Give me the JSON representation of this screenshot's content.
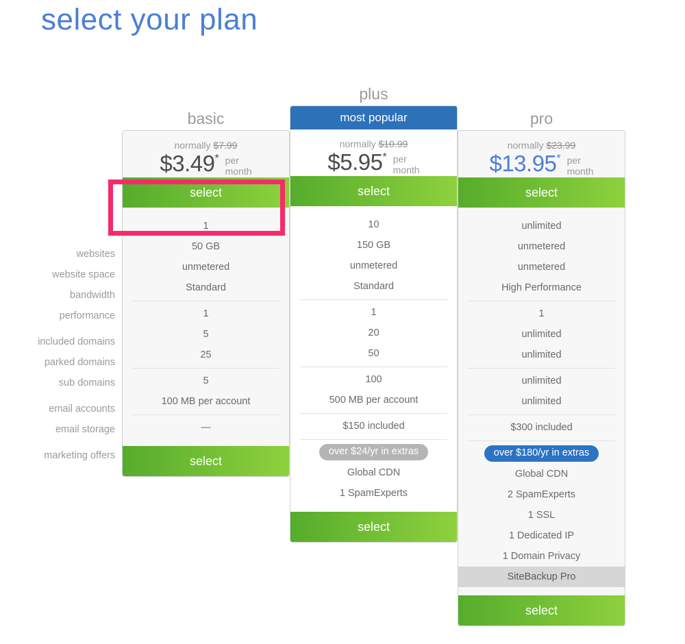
{
  "heading": "select your plan",
  "features": [
    {
      "label": "websites",
      "group": 0
    },
    {
      "label": "website space",
      "group": 0
    },
    {
      "label": "bandwidth",
      "group": 0
    },
    {
      "label": "performance",
      "group": 0
    },
    {
      "label": "included domains",
      "group": 1
    },
    {
      "label": "parked domains",
      "group": 1
    },
    {
      "label": "sub domains",
      "group": 1
    },
    {
      "label": "email accounts",
      "group": 2
    },
    {
      "label": "email storage",
      "group": 2
    },
    {
      "label": "marketing offers",
      "group": 3
    }
  ],
  "plans": {
    "basic": {
      "title": "basic",
      "badge": null,
      "normally_label": "normally",
      "old_price": "$7.99",
      "price": "$3.49",
      "price_star": "*",
      "per": "per",
      "month": "month",
      "select_label": "select",
      "select_label_bottom": "select",
      "values": [
        "1",
        "50 GB",
        "unmetered",
        "Standard",
        "1",
        "5",
        "25",
        "5",
        "100 MB per account",
        "—"
      ],
      "extras_pill": null,
      "extras": []
    },
    "plus": {
      "title": "plus",
      "badge": "most popular",
      "normally_label": "normally",
      "old_price": "$10.99",
      "price": "$5.95",
      "price_star": "*",
      "per": "per",
      "month": "month",
      "select_label": "select",
      "select_label_bottom": "select",
      "values": [
        "10",
        "150 GB",
        "unmetered",
        "Standard",
        "1",
        "20",
        "50",
        "100",
        "500 MB per account",
        "$150 included"
      ],
      "extras_pill": "over $24/yr in extras",
      "extras": [
        "Global CDN",
        "1 SpamExperts"
      ]
    },
    "pro": {
      "title": "pro",
      "badge": null,
      "normally_label": "normally",
      "old_price": "$23.99",
      "price": "$13.95",
      "price_star": "*",
      "per": "per",
      "month": "month",
      "select_label": "select",
      "select_label_bottom": "select",
      "values": [
        "unlimited",
        "unmetered",
        "unmetered",
        "High Performance",
        "1",
        "unlimited",
        "unlimited",
        "unlimited",
        "unlimited",
        "$300 included"
      ],
      "extras_pill": "over $180/yr in extras",
      "extras": [
        "Global CDN",
        "2 SpamExperts",
        "1 SSL",
        "1 Dedicated IP",
        "1 Domain Privacy",
        "SiteBackup Pro"
      ],
      "highlighted_extra": "SiteBackup Pro"
    }
  },
  "colors": {
    "heading_blue": "#4a7fd6",
    "select_green_dark": "#56ac2c",
    "select_green_light": "#8ed13d",
    "popular_blue": "#2d72b8",
    "pill_gray": "#b5b5b5",
    "pill_blue": "#2c73c4",
    "annotation_pink": "#f72b6a",
    "pro_price_blue": "#4a7fd6"
  },
  "annotation": {
    "target": "basic-select-button"
  }
}
